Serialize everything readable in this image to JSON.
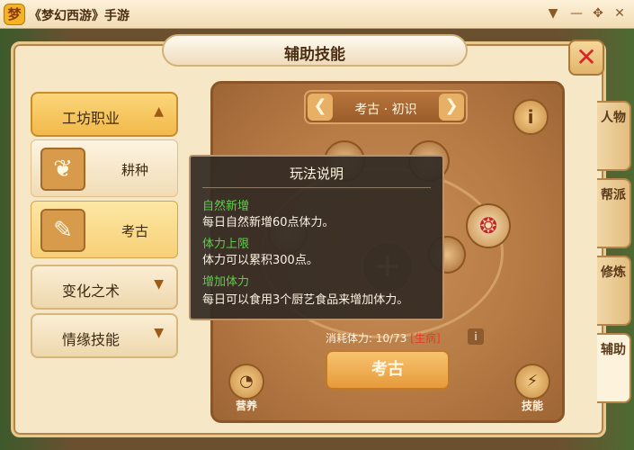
{
  "window": {
    "logo_glyph": "梦",
    "title": "《梦幻西游》手游",
    "buttons": [
      "▼",
      "—",
      "✥",
      "✕"
    ]
  },
  "panel": {
    "title": "辅助技能",
    "close_glyph": "✕"
  },
  "side_tabs": [
    {
      "label": "人物",
      "active": false
    },
    {
      "label": "帮派",
      "active": false
    },
    {
      "label": "修炼",
      "active": false
    },
    {
      "label": "辅助",
      "active": true
    }
  ],
  "categories": [
    {
      "label": "工坊职业",
      "chevron": "▲",
      "active": true
    },
    {
      "label": "变化之术",
      "chevron": "▼",
      "active": false
    },
    {
      "label": "情缘技能",
      "chevron": "▼",
      "active": false
    }
  ],
  "sub_items": [
    {
      "label": "耕种",
      "icon": "wheat-icon",
      "glyph": "❦",
      "active": false
    },
    {
      "label": "考古",
      "icon": "shovel-icon",
      "glyph": "✎",
      "active": true
    }
  ],
  "skill": {
    "name": "考古 · 初识",
    "prev_glyph": "❮",
    "next_glyph": "❯",
    "info_glyph": "i",
    "plus_glyph": "+",
    "jar_glyph": "❂"
  },
  "cost": {
    "text": "消耗体力: 10/73",
    "tag": "[生病]",
    "info_glyph": "i"
  },
  "action_button": "考古",
  "corner_buttons": [
    {
      "label": "营养",
      "glyph": "◔"
    },
    {
      "label": "技能",
      "glyph": "⚡"
    }
  ],
  "tooltip": {
    "title": "玩法说明",
    "sections": [
      {
        "heading": "自然新增",
        "body": "每日自然新增60点体力。"
      },
      {
        "heading": "体力上限",
        "body": "体力可以累积300点。"
      },
      {
        "heading": "增加体力",
        "body": "每日可以食用3个厨艺食品来增加体力。"
      }
    ]
  },
  "colors": {
    "heading_green": "#5ad04a",
    "warning_red": "#e63a2c",
    "accent_gold": "#f1b94a"
  }
}
